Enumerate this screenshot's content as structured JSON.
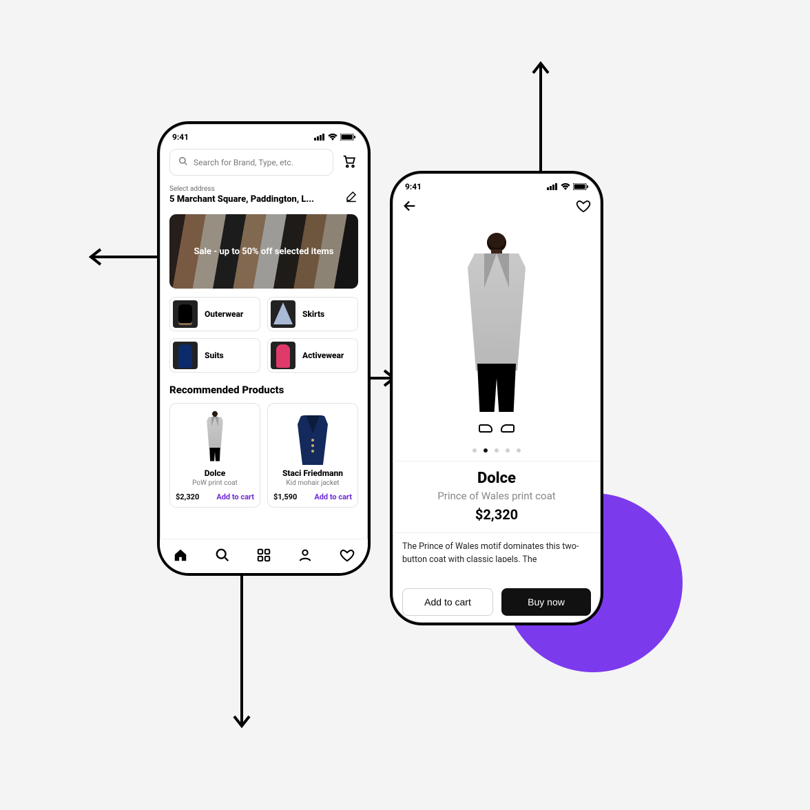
{
  "colors": {
    "accent": "#7C3AED",
    "link": "#6D28D9"
  },
  "status": {
    "time": "9:41"
  },
  "screenHome": {
    "search": {
      "placeholder": "Search for Brand, Type, etc."
    },
    "address": {
      "label": "Select address",
      "value": "5 Marchant Square, Paddington, L..."
    },
    "banner": {
      "text": "Sale - up to 50% off selected items"
    },
    "categories": [
      {
        "label": "Outerwear"
      },
      {
        "label": "Skirts"
      },
      {
        "label": "Suits"
      },
      {
        "label": "Activewear"
      }
    ],
    "recommended": {
      "title": "Recommended Products",
      "addLabel": "Add to cart",
      "items": [
        {
          "brand": "Dolce",
          "name": "PoW print coat",
          "price": "$2,320"
        },
        {
          "brand": "Staci Friedmann",
          "name": "Kid mohair jacket",
          "price": "$1,590"
        }
      ]
    }
  },
  "screenProduct": {
    "imageCount": 5,
    "activeImageIndex": 1,
    "brand": "Dolce",
    "title": "Prince of Wales print coat",
    "price": "$2,320",
    "description": "The Prince of Wales motif dominates this two-button coat with classic lapels. The",
    "addToCart": "Add to cart",
    "buyNow": "Buy now"
  }
}
